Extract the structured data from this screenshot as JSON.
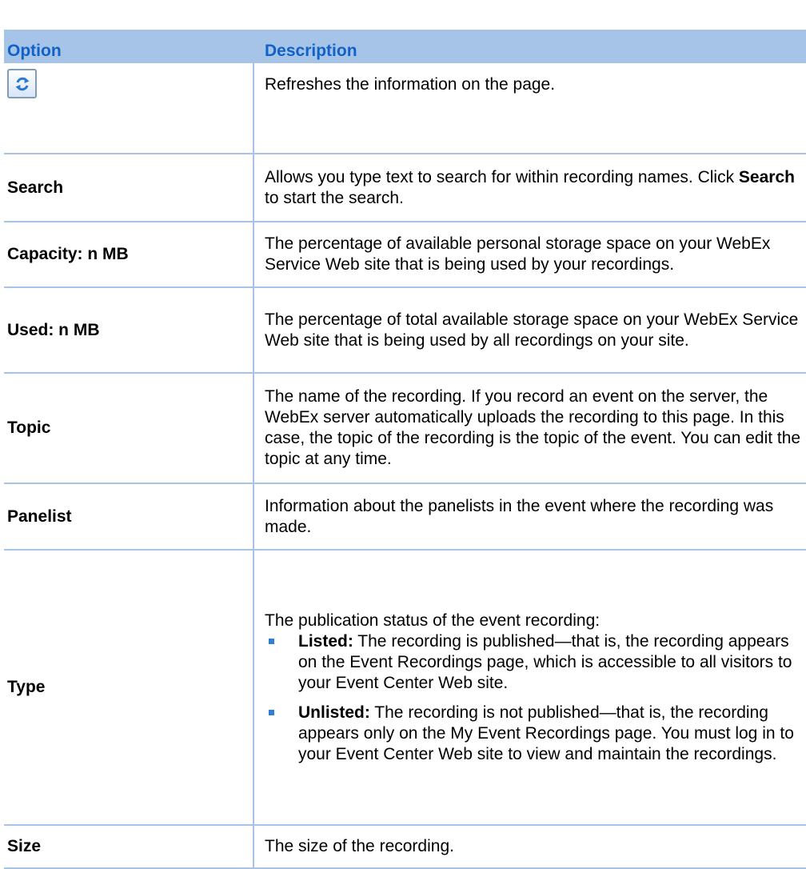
{
  "header": {
    "option": "Option",
    "description": "Description"
  },
  "rows": {
    "refresh": {
      "icon": "refresh-icon",
      "description": "Refreshes the information on the page."
    },
    "search": {
      "option": "Search",
      "description_pre": "Allows you type text to search for within recording names. Click ",
      "description_bold": "Search",
      "description_post": " to start the search."
    },
    "capacity": {
      "option": "Capacity: n MB",
      "description": "The percentage of available personal storage space on your WebEx Service Web site that is being used by your recordings."
    },
    "used": {
      "option": "Used: n MB",
      "description": "The percentage of total available storage space on your WebEx Service Web site that is being used by all recordings on your site."
    },
    "topic": {
      "option": "Topic",
      "description": "The name of the recording. If you record an event on the server, the WebEx server automatically uploads the recording to this page. In this case, the topic of the recording is the topic of the event. You can edit the topic at any time."
    },
    "panelist": {
      "option": "Panelist",
      "description": "Information about the panelists in the event where the recording was made."
    },
    "type": {
      "option": "Type",
      "intro": "The publication status of the event recording:",
      "bullets": [
        {
          "term": "Listed:",
          "text": " The recording is published—that is, the recording appears on the Event Recordings page, which is accessible to all visitors to your Event Center Web site."
        },
        {
          "term": "Unlisted:",
          "text": " The recording is not published—that is, the recording appears only on the My Event Recordings page. You must log in to your Event Center Web site to view and maintain the recordings."
        }
      ]
    },
    "size": {
      "option": "Size",
      "description": "The size of the recording."
    }
  },
  "colors": {
    "header_bg": "#a6c4e8",
    "header_text": "#1261c8",
    "bullet": "#2f7fd3",
    "icon_arrow": "#2b78d0"
  }
}
